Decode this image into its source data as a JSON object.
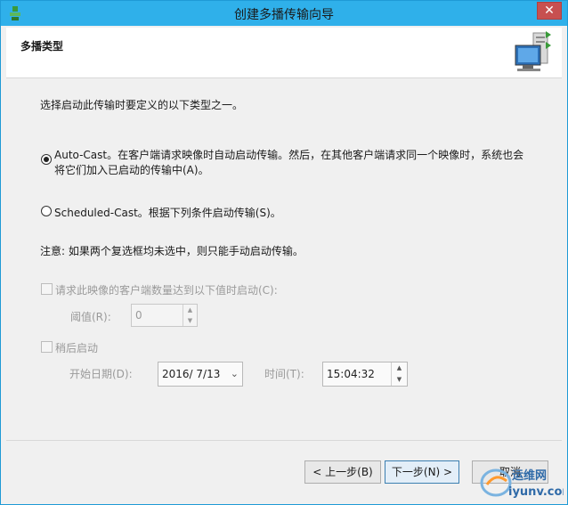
{
  "window": {
    "title": "创建多播传输向导",
    "close_glyph": "✕"
  },
  "header": {
    "title": "多播类型"
  },
  "content": {
    "instruction": "选择启动此传输时要定义的以下类型之一。",
    "option_autocast": {
      "line1": "Auto-Cast。在客户端请求映像时自动启动传输。然后，在其他客户端请求同一个映像时，系统也会",
      "line2": "将它们加入已启动的传输中(A)。",
      "selected": true
    },
    "option_scheduled": {
      "label": "Scheduled-Cast。根据下列条件启动传输(S)。",
      "selected": false
    },
    "note": "注意: 如果两个复选框均未选中，则只能手动启动传输。",
    "client_threshold": {
      "label": "请求此映像的客户端数量达到以下值时启动(C):",
      "checked": false,
      "threshold_label": "阈值(R):",
      "threshold_value": "0"
    },
    "delayed_start": {
      "label": "稍后启动",
      "checked": false,
      "date_label": "开始日期(D):",
      "date_value": "2016/  7/13",
      "time_label": "时间(T):",
      "time_value": "15:04:32"
    }
  },
  "footer": {
    "back_label": "< 上一步(B)",
    "next_label": "下一步(N) >",
    "cancel_label": "取消"
  },
  "watermark": {
    "line1": "运维网",
    "line2": "iyunv.com"
  },
  "colors": {
    "titlebar": "#2fb0ea",
    "close_button": "#c75050",
    "accent_border": "#3c7fb1"
  }
}
